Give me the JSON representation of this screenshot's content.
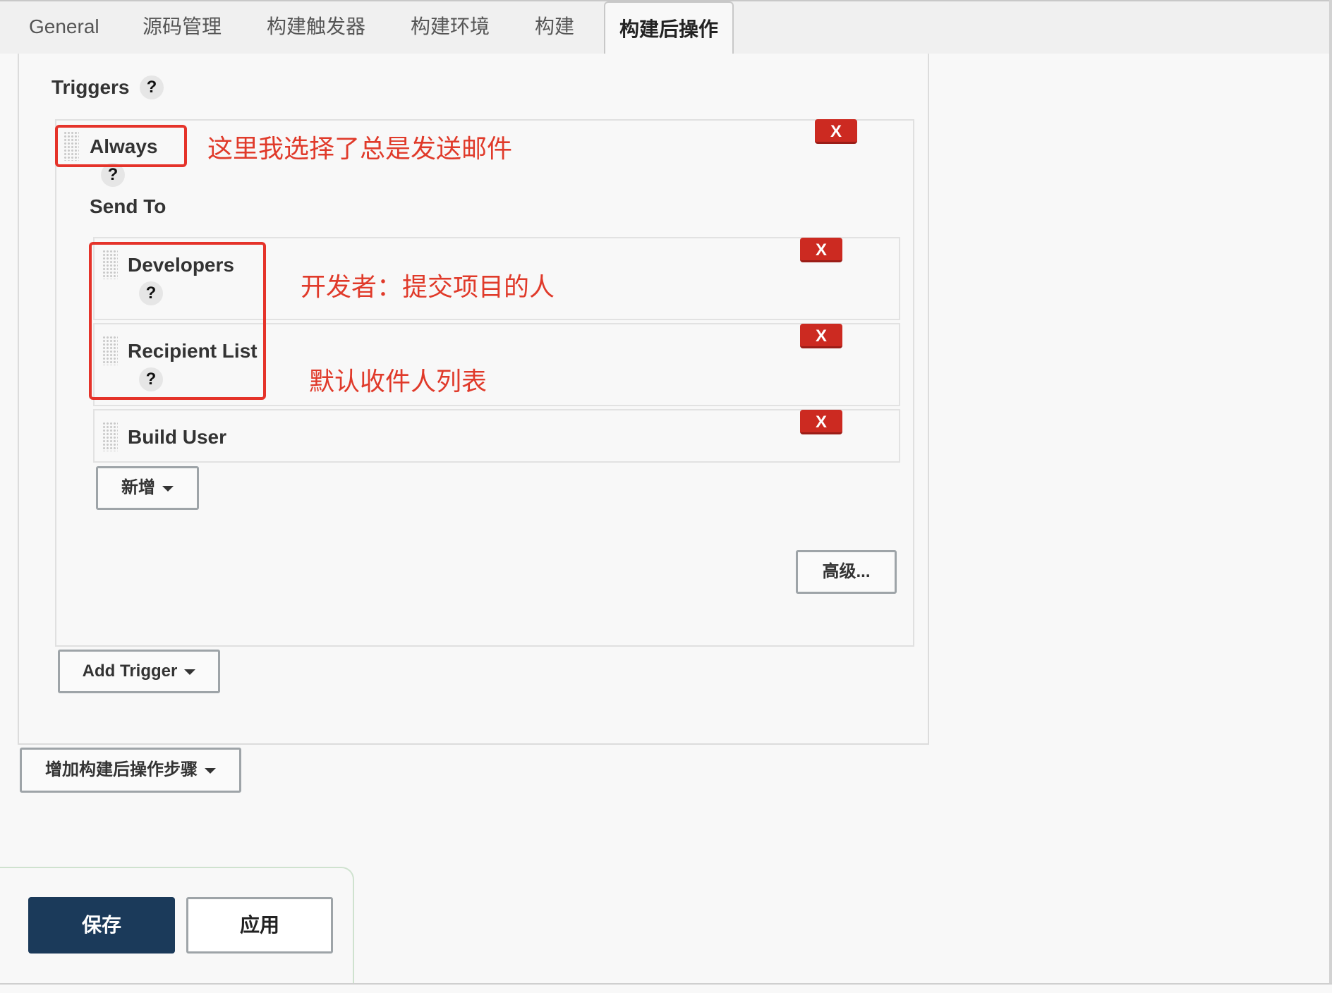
{
  "tabs": [
    "General",
    "源码管理",
    "构建触发器",
    "构建环境",
    "构建",
    "构建后操作"
  ],
  "triggers": {
    "title": "Triggers",
    "help": "?",
    "always": {
      "label": "Always",
      "help": "?",
      "remove": "X"
    },
    "send_to_label": "Send To",
    "recipients": [
      {
        "label": "Developers",
        "help": "?",
        "remove": "X"
      },
      {
        "label": "Recipient List",
        "help": "?",
        "remove": "X"
      },
      {
        "label": "Build User",
        "remove": "X"
      }
    ],
    "add_recipient": "新增",
    "advanced": "高级...",
    "add_trigger": "Add Trigger"
  },
  "add_post_build_step": "增加构建后操作步骤",
  "annotations": {
    "always_note": "这里我选择了总是发送邮件",
    "developers_note": "开发者：提交项目的人",
    "recipient_list_note": "默认收件人列表"
  },
  "footer": {
    "save": "保存",
    "apply": "应用"
  },
  "colors": {
    "delete_red": "#cc2a21",
    "annotation_red": "#e5332a",
    "save_blue": "#1b3a5a"
  }
}
